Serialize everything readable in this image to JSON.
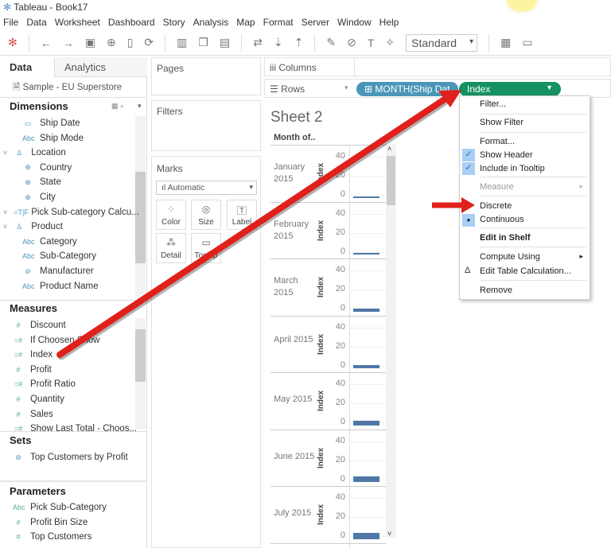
{
  "window": {
    "title": "Tableau - Book17"
  },
  "menubar": [
    "File",
    "Data",
    "Worksheet",
    "Dashboard",
    "Story",
    "Analysis",
    "Map",
    "Format",
    "Server",
    "Window",
    "Help"
  ],
  "toolbar": {
    "fit_select": "Standard"
  },
  "left_pane": {
    "tabs": [
      "Data",
      "Analytics"
    ],
    "datasource": "Sample - EU Superstore",
    "dimensions_header": "Dimensions",
    "dimensions": [
      {
        "label": "Ship Date",
        "icon": "calendar-icon",
        "sub": true
      },
      {
        "label": "Ship Mode",
        "icon": "abc-icon",
        "sub": true
      },
      {
        "label": "Location",
        "icon": "hierarchy-icon",
        "sub": false
      },
      {
        "label": "Country",
        "icon": "globe-icon",
        "sub": true
      },
      {
        "label": "State",
        "icon": "globe-icon",
        "sub": true
      },
      {
        "label": "City",
        "icon": "globe-icon",
        "sub": true
      },
      {
        "label": "Pick Sub-category Calcu...",
        "icon": "calc-icon",
        "sub": false
      },
      {
        "label": "Product",
        "icon": "hierarchy-icon",
        "sub": false
      },
      {
        "label": "Category",
        "icon": "abc-icon",
        "sub": true
      },
      {
        "label": "Sub-Category",
        "icon": "abc-icon",
        "sub": true
      },
      {
        "label": "Manufacturer",
        "icon": "group-icon",
        "sub": true
      },
      {
        "label": "Product Name",
        "icon": "abc-icon",
        "sub": true
      }
    ],
    "measures_header": "Measures",
    "measures": [
      "Discount",
      "If Choosen Show",
      "Index",
      "Profit",
      "Profit Ratio",
      "Quantity",
      "Sales",
      "Show Last Total  - Choos..."
    ],
    "sets_header": "Sets",
    "sets": [
      "Top Customers by Profit"
    ],
    "parameters_header": "Parameters",
    "parameters": [
      "Pick Sub-Category",
      "Profit Bin Size",
      "Top Customers"
    ]
  },
  "cards": {
    "pages": "Pages",
    "filters": "Filters",
    "marks": "Marks",
    "mark_type": "Automatic",
    "mark_buttons": [
      "Color",
      "Size",
      "Label",
      "Detail",
      "Tooltip"
    ]
  },
  "shelves": {
    "columns": "Columns",
    "rows": "Rows",
    "pills": [
      "MONTH(Ship Dat..",
      "Index"
    ]
  },
  "sheet": {
    "title": "Sheet 2",
    "row_header": "Month of..",
    "axis_label": "Index",
    "ticks": [
      "40",
      "20",
      "0"
    ]
  },
  "context_menu": {
    "items": [
      "Filter...",
      "Show Filter",
      "Format...",
      "Show Header",
      "Include in Tooltip",
      "Measure",
      "Discrete",
      "Continuous",
      "Edit in Shelf",
      "Compute Using",
      "Edit Table Calculation...",
      "Remove"
    ]
  },
  "chart_data": {
    "type": "bar",
    "categories": [
      "January 2015",
      "February 2015",
      "March 2015",
      "April 2015",
      "May 2015",
      "June 2015",
      "July 2015"
    ],
    "values": [
      1,
      2,
      3,
      4,
      5,
      6,
      7
    ],
    "ylabel": "Index",
    "ylim": [
      0,
      45
    ]
  },
  "colors": {
    "pill_blue": "#4b96b8",
    "pill_green": "#169162",
    "bar": "#4e79a7",
    "arrow": "#e0201b"
  }
}
